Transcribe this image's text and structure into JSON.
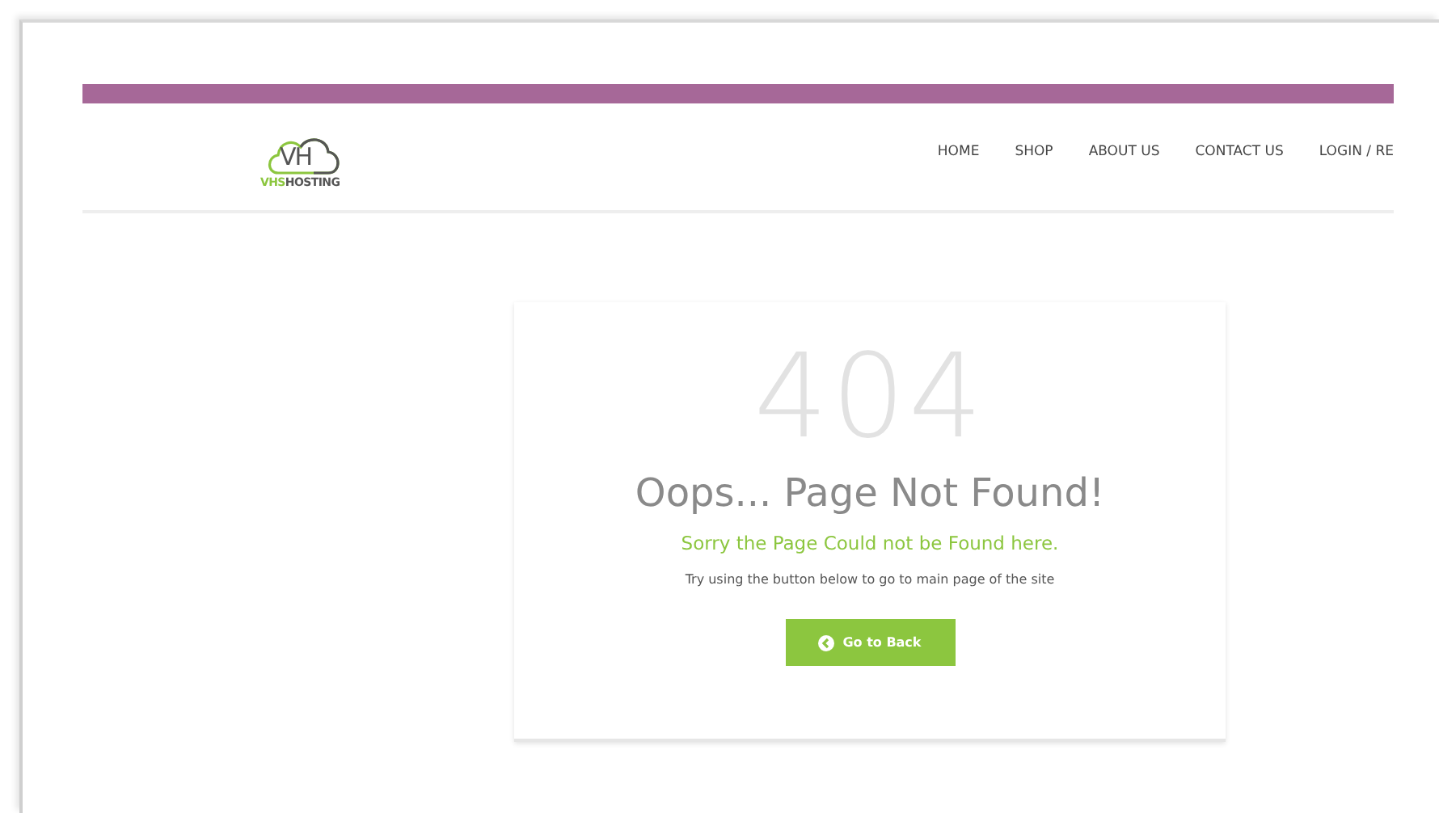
{
  "logo": {
    "mark": "VH",
    "name_first": "VHS",
    "name_rest": "HOSTING"
  },
  "nav": [
    {
      "label": "HOME"
    },
    {
      "label": "SHOP"
    },
    {
      "label": "ABOUT US"
    },
    {
      "label": "CONTACT US"
    },
    {
      "label": "LOGIN / RE"
    }
  ],
  "error": {
    "code": "404",
    "title": "Oops... Page Not Found!",
    "subtitle": "Sorry the Page Could not be Found here.",
    "hint": "Try using the button below to go to main page of the site",
    "button": "Go to Back"
  }
}
